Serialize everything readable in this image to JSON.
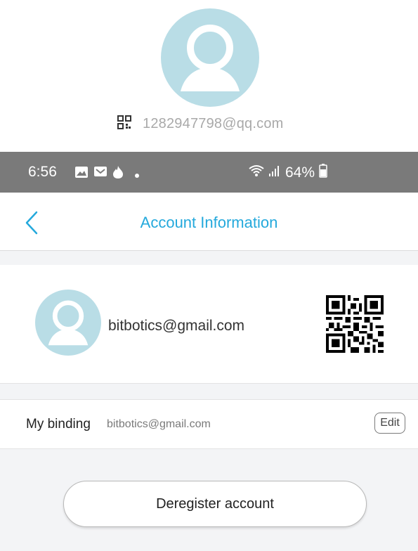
{
  "top_profile": {
    "user_id": "1282947798@qq.com",
    "avatar_icon": "user-avatar-icon",
    "qr_icon": "qr-code-icon"
  },
  "status_bar": {
    "time": "6:56",
    "battery": "64%",
    "icons": [
      "gallery-icon",
      "message-icon",
      "tinder-flame-icon",
      "dot-icon",
      "wifi-icon",
      "signal-icon",
      "battery-icon"
    ]
  },
  "nav": {
    "title": "Account Information",
    "back_icon": "chevron-left-icon"
  },
  "profile": {
    "email": "bitbotics@gmail.com",
    "avatar_icon": "user-avatar-icon",
    "qr_icon": "qr-code-icon"
  },
  "binding": {
    "label": "My binding",
    "value": "bitbotics@gmail.com",
    "edit_label": "Edit"
  },
  "actions": {
    "deregister_label": "Deregister account"
  },
  "colors": {
    "accent": "#24a9dc",
    "avatar_bg": "#b9dde6",
    "status_bar_bg": "#7a7a7a",
    "section_gap_bg": "#f3f4f6"
  }
}
